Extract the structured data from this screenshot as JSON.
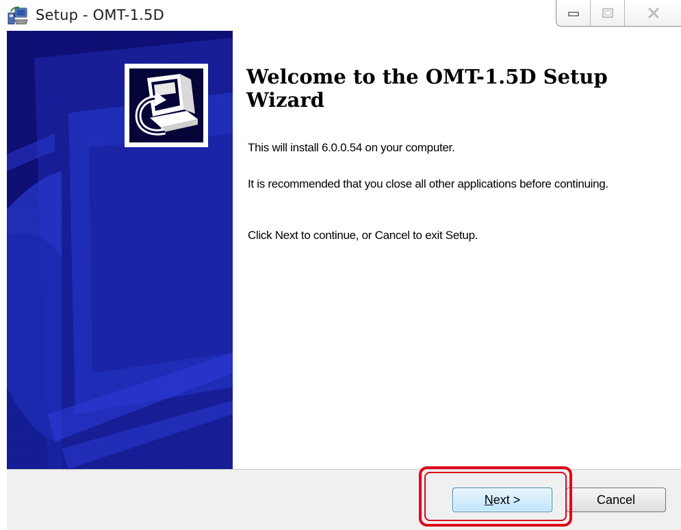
{
  "window": {
    "title": "Setup - OMT-1.5D",
    "icon": "setup-installer-icon",
    "controls": [
      "minimize-icon",
      "maximize-icon",
      "close-icon"
    ]
  },
  "wizard": {
    "heading": "Welcome to the OMT-1.5D Setup Wizard",
    "paragraphs": [
      "This will install 6.0.0.54 on your computer.",
      "It is recommended that you close all other applications before continuing.",
      "Click Next to continue, or Cancel to exit Setup."
    ],
    "logo": "computer-install-icon"
  },
  "buttons": {
    "next_mnemonic": "N",
    "next_rest": "ext >",
    "cancel": "Cancel"
  },
  "colors": {
    "side_panel": "#0d0d72",
    "highlight": "#e0001a",
    "default_button_border": "#3c7fb1"
  }
}
